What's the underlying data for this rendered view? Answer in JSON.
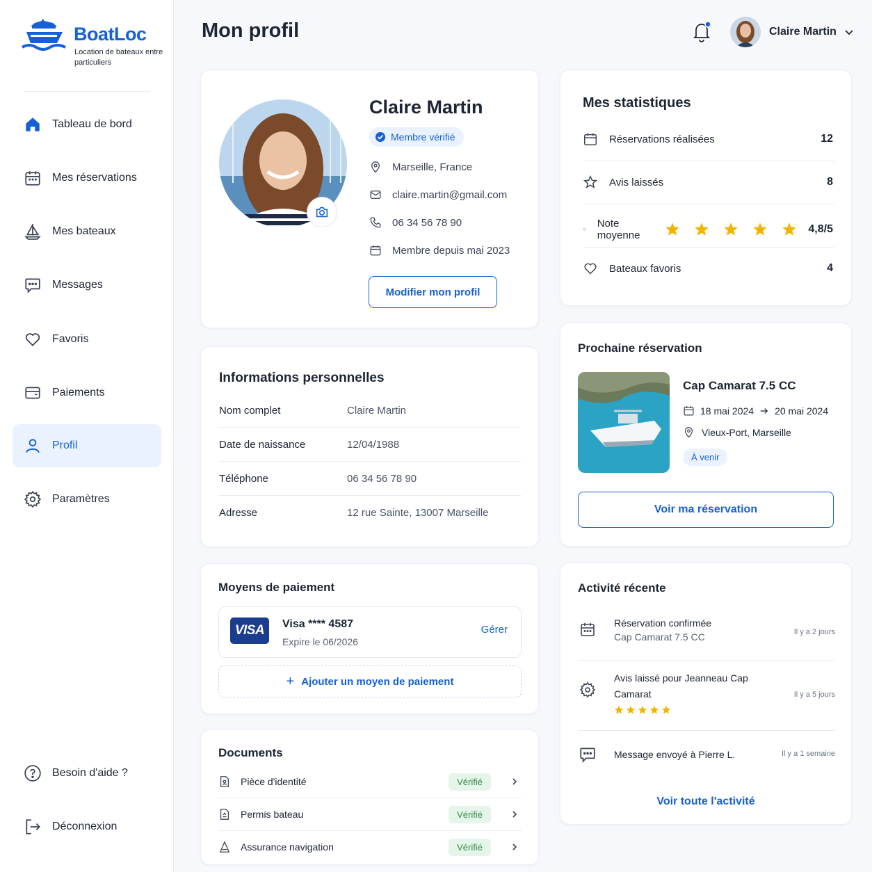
{
  "brand": {
    "name": "BoatLoc",
    "tagline": "Location de bateaux entre particuliers",
    "accent": "#1560d4"
  },
  "sidebar": {
    "items": [
      {
        "label": "Tableau de bord",
        "icon": "home-icon"
      },
      {
        "label": "Mes réservations",
        "icon": "calendar-icon"
      },
      {
        "label": "Mes bateaux",
        "icon": "sailboat-icon"
      },
      {
        "label": "Messages",
        "icon": "message-icon"
      },
      {
        "label": "Favoris",
        "icon": "heart-icon"
      },
      {
        "label": "Paiements",
        "icon": "wallet-icon"
      },
      {
        "label": "Profil",
        "icon": "user-icon",
        "active": true
      },
      {
        "label": "Paramètres",
        "icon": "gear-icon"
      }
    ],
    "help": "Besoin d'aide ?",
    "logout": "Déconnexion"
  },
  "header": {
    "title": "Mon profil",
    "user_name": "Claire Martin"
  },
  "profile": {
    "name": "Claire Martin",
    "badge": "Membre vérifié",
    "location": "Marseille, France",
    "email": "claire.martin@gmail.com",
    "phone": "06 34 56 78 90",
    "member_since": "Membre depuis mai 2023",
    "edit_button": "Modifier mon profil"
  },
  "personal_info": {
    "title": "Informations personnelles",
    "rows": [
      {
        "label": "Nom complet",
        "value": "Claire Martin"
      },
      {
        "label": "Date de naissance",
        "value": "12/04/1988"
      },
      {
        "label": "Téléphone",
        "value": "06 34 56 78 90"
      },
      {
        "label": "Adresse",
        "value": "12 rue Sainte, 13007 Marseille"
      }
    ]
  },
  "payment": {
    "title": "Moyens de paiement",
    "card_brand": "VISA",
    "card_label": "Visa **** 4587",
    "card_expiry": "Expire le 06/2026",
    "manage": "Gérer",
    "add": "Ajouter un moyen de paiement"
  },
  "documents": {
    "title": "Documents",
    "items": [
      {
        "label": "Pièce d'identité",
        "status": "Vérifié"
      },
      {
        "label": "Permis bateau",
        "status": "Vérifié"
      },
      {
        "label": "Assurance navigation",
        "status": "Vérifié"
      }
    ]
  },
  "stats": {
    "title": "Mes statistiques",
    "rows": [
      {
        "label": "Réservations réalisées",
        "value": "12"
      },
      {
        "label": "Avis laissés",
        "value": "8"
      },
      {
        "label": "Note moyenne",
        "value": "4,8/5",
        "stars": 5
      },
      {
        "label": "Bateaux favoris",
        "value": "4"
      }
    ]
  },
  "next_booking": {
    "title": "Prochaine réservation",
    "boat": "Cap Camarat 7.5 CC",
    "date_from": "18 mai 2024",
    "date_to": "20 mai 2024",
    "place": "Vieux-Port, Marseille",
    "status": "À venir",
    "button": "Voir ma réservation"
  },
  "activity": {
    "title": "Activité récente",
    "items": [
      {
        "title": "Réservation confirmée",
        "sub": "Cap Camarat 7.5 CC",
        "time": "Il y a 2 jours",
        "icon": "calendar-icon"
      },
      {
        "title": "Avis laissé pour Jeanneau Cap Camarat",
        "time": "Il y a 5 jours",
        "icon": "gear-icon",
        "stars": 5
      },
      {
        "title": "Message envoyé à Pierre L.",
        "time": "Il y a 1 semaine",
        "icon": "message-icon"
      }
    ],
    "link": "Voir toute l'activité"
  }
}
